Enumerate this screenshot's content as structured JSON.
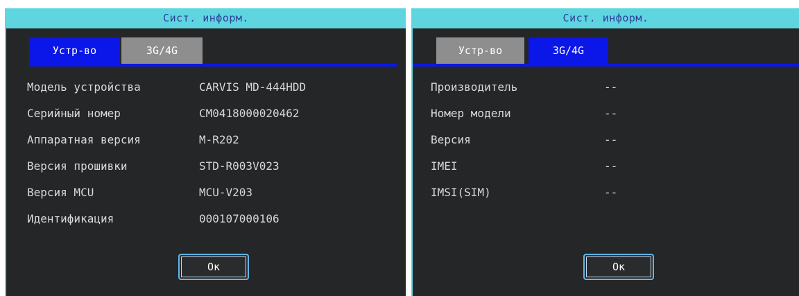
{
  "left_panel": {
    "title": "Сист. информ.",
    "tabs": [
      {
        "label": "Устр-во",
        "active": true
      },
      {
        "label": "3G/4G",
        "active": false
      }
    ],
    "rows": [
      {
        "label": "Модель устройства",
        "value": "CARVIS MD-444HDD"
      },
      {
        "label": "Серийный номер",
        "value": "CM0418000020462"
      },
      {
        "label": "Аппаратная версия",
        "value": "M-R202"
      },
      {
        "label": "Версия прошивки",
        "value": "STD-R003V023"
      },
      {
        "label": "Версия MCU",
        "value": "MCU-V203"
      },
      {
        "label": "Идентификация",
        "value": "000107000106"
      }
    ],
    "ok_label": "Ок"
  },
  "right_panel": {
    "title": "Сист. информ.",
    "tabs": [
      {
        "label": "Устр-во",
        "active": false
      },
      {
        "label": "3G/4G",
        "active": true
      }
    ],
    "rows": [
      {
        "label": "Производитель",
        "value": "--"
      },
      {
        "label": "Номер модели",
        "value": "--"
      },
      {
        "label": "Версия",
        "value": "--"
      },
      {
        "label": "IMEI",
        "value": "--"
      },
      {
        "label": "IMSI(SIM)",
        "value": "--"
      }
    ],
    "ok_label": "Ок"
  },
  "colors": {
    "title_bar": "#5fd5e0",
    "active_tab": "#0b16e8",
    "inactive_tab": "#8e8e8e",
    "panel_bg": "#252628"
  }
}
